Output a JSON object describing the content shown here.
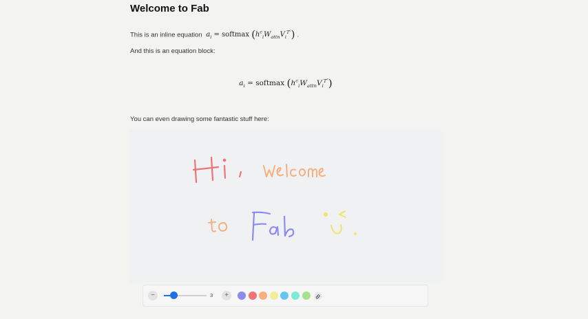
{
  "document": {
    "title": "Welcome to Fab",
    "inline_text": "This is an inline equation",
    "inline_period": ".",
    "block_intro": "And this is an equation block:",
    "drawing_intro": "You can even drawing some fantastic stuff here:"
  },
  "equation": {
    "lhs": "a",
    "lhs_sub": "i",
    "equals": "=",
    "func": "softmax",
    "h": "h",
    "h_sub": "i",
    "h_sup": "c",
    "W": "W",
    "W_sub": "attn",
    "V": "V",
    "V_sub": "i",
    "V_sup": "T",
    "V_sup2": "c"
  },
  "drawing": {
    "strokes_text": [
      "Hi,",
      "Welcome",
      "to",
      "Fab",
      "˘͡"
    ],
    "colors": {
      "hi": "#ee7474",
      "welcome": "#f6b07e",
      "to": "#f6b07e",
      "fab": "#8b8bee",
      "smiley": "#f0e46a"
    }
  },
  "toolbar": {
    "minus_icon": "minus-icon",
    "plus_icon": "plus-icon",
    "minus_label": "−",
    "plus_label": "+",
    "brush_size": "3",
    "brush_fraction": 0.22,
    "palette": [
      "#8b8bee",
      "#ee7474",
      "#f6b07e",
      "#f1ed9a",
      "#67c6ef",
      "#7ee9d6",
      "#a4e48c"
    ],
    "eraser_icon": "eraser-icon"
  }
}
